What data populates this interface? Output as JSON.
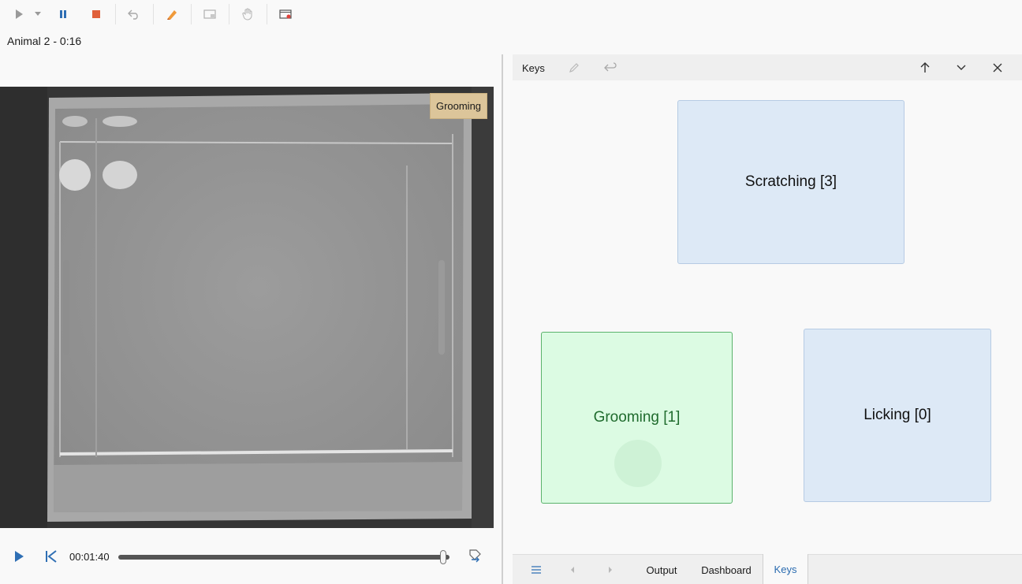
{
  "session": {
    "label": "Animal 2 - 0:16"
  },
  "toolbar": {
    "icons": [
      "play-icon",
      "dropdown-icon",
      "pause-icon",
      "stop-icon",
      "undo-icon",
      "marker-icon",
      "screen-icon",
      "hand-icon",
      "record-icon"
    ]
  },
  "video": {
    "tag_label": "Grooming"
  },
  "playback": {
    "time": "00:01:40",
    "progress": 0.99
  },
  "keys_panel": {
    "title": "Keys"
  },
  "keys": {
    "scratching": {
      "label": "Scratching [3]"
    },
    "grooming": {
      "label": "Grooming [1]"
    },
    "licking": {
      "label": "Licking [0]"
    }
  },
  "bottom_tabs": {
    "output": "Output",
    "dashboard": "Dashboard",
    "keys": "Keys",
    "active": "Keys"
  },
  "colors": {
    "accent": "#2b6cb0",
    "key_blue": "#dde9f6",
    "key_green": "#dcfbe3",
    "tag": "#dcc59a"
  }
}
